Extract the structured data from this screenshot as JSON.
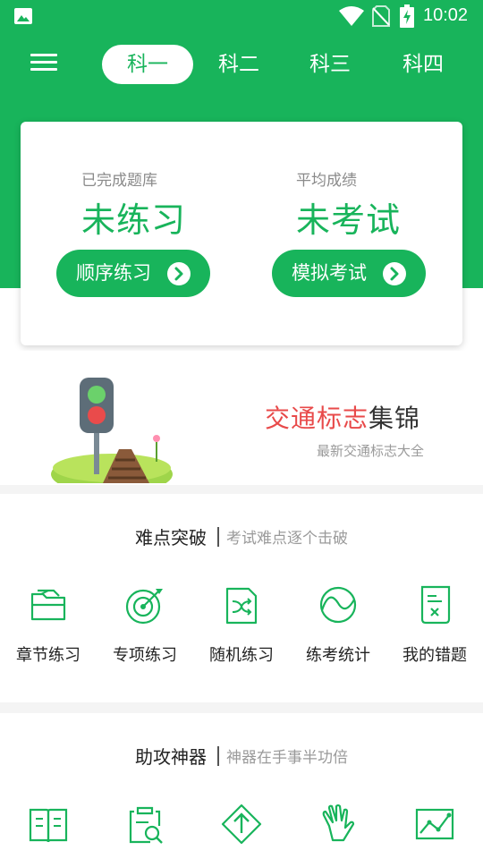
{
  "status_bar": {
    "time": "10:02"
  },
  "tabs": [
    {
      "label": "科一",
      "active": true
    },
    {
      "label": "科二",
      "active": false
    },
    {
      "label": "科三",
      "active": false
    },
    {
      "label": "科四",
      "active": false
    }
  ],
  "card": {
    "left": {
      "label": "已完成题库",
      "value": "未练习",
      "button": "顺序练习"
    },
    "right": {
      "label": "平均成绩",
      "value": "未考试",
      "button": "模拟考试"
    }
  },
  "banner": {
    "title_red": "交通标志",
    "title_dark": "集锦",
    "subtitle": "最新交通标志大全"
  },
  "section1": {
    "title": "难点突破",
    "subtitle": "考试难点逐个击破",
    "items": [
      {
        "label": "章节练习",
        "icon": "folder-icon"
      },
      {
        "label": "专项练习",
        "icon": "target-icon"
      },
      {
        "label": "随机练习",
        "icon": "shuffle-file-icon"
      },
      {
        "label": "练考统计",
        "icon": "wave-chart-icon"
      },
      {
        "label": "我的错题",
        "icon": "wrong-note-icon"
      }
    ]
  },
  "section2": {
    "title": "助攻神器",
    "subtitle": "神器在手事半功倍",
    "items": [
      {
        "icon": "book-icon"
      },
      {
        "icon": "clipboard-search-icon"
      },
      {
        "icon": "arrow-sign-icon"
      },
      {
        "icon": "hand-gesture-icon"
      },
      {
        "icon": "trend-chart-icon"
      }
    ]
  },
  "colors": {
    "primary": "#18b45b",
    "accent_red": "#e84a4a",
    "text_dark": "#222222",
    "text_gray": "#9a9a9a"
  }
}
